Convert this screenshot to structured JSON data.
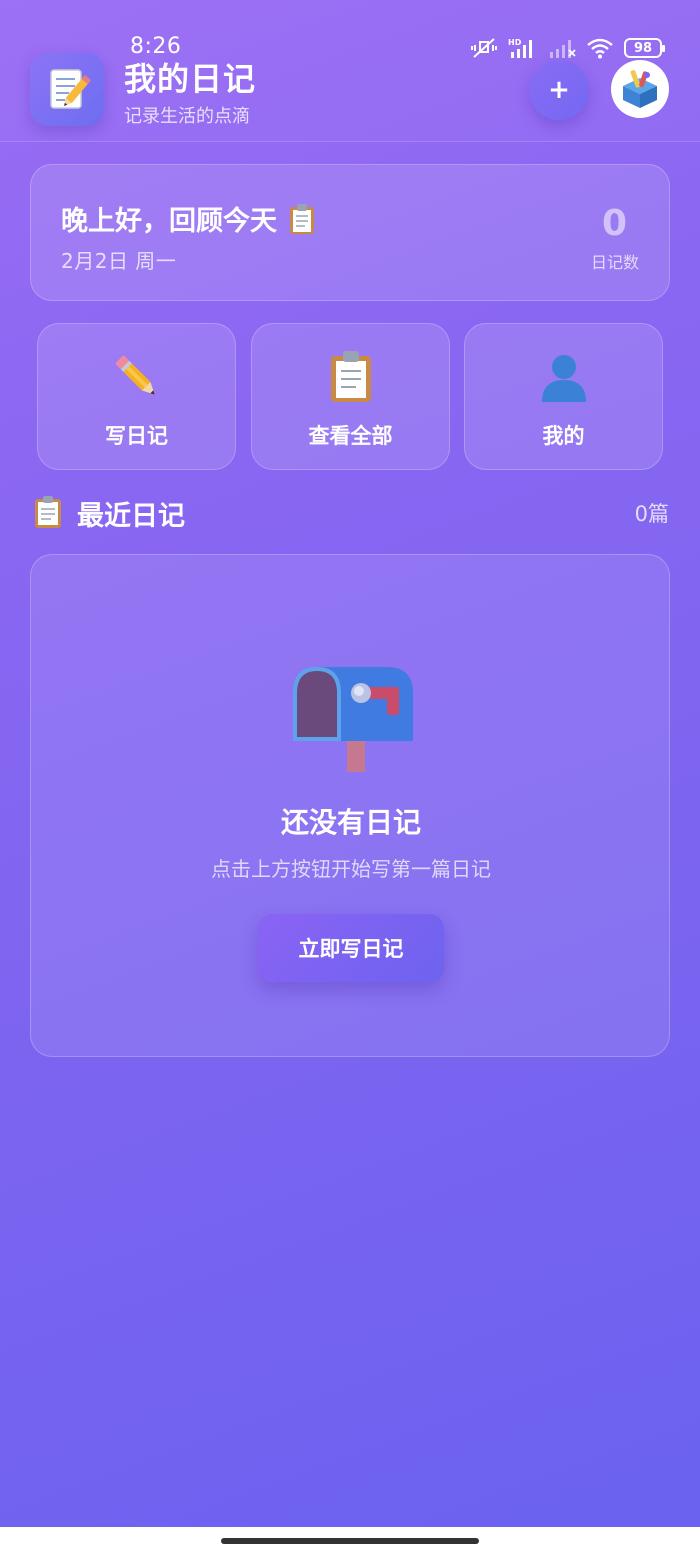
{
  "status_bar": {
    "time": "8:26",
    "hd_label": "HD",
    "battery": "98"
  },
  "header": {
    "logo_icon": "memo-icon",
    "title": "我的日记",
    "subtitle": "记录生活的点滴",
    "add_label": "+",
    "avatar_icon": "toolbox-icon"
  },
  "greeting": {
    "text": "晚上好，回顾今天",
    "icon": "clipboard-icon",
    "date": "2月2日 周一",
    "count_value": "0",
    "count_label": "日记数"
  },
  "actions": [
    {
      "label": "写日记",
      "icon": "pencil-icon"
    },
    {
      "label": "查看全部",
      "icon": "clipboard-icon"
    },
    {
      "label": "我的",
      "icon": "user-silhouette-icon"
    }
  ],
  "recent": {
    "icon": "clipboard-icon",
    "title": "最近日记",
    "count": "0篇"
  },
  "empty_state": {
    "icon": "mailbox-icon",
    "title": "还没有日记",
    "subtitle": "点击上方按钮开始写第一篇日记",
    "button_label": "立即写日记"
  },
  "colors": {
    "background_top": "#9a6cf4",
    "background_bottom": "#6a62f0",
    "accent": "#7368f1"
  }
}
